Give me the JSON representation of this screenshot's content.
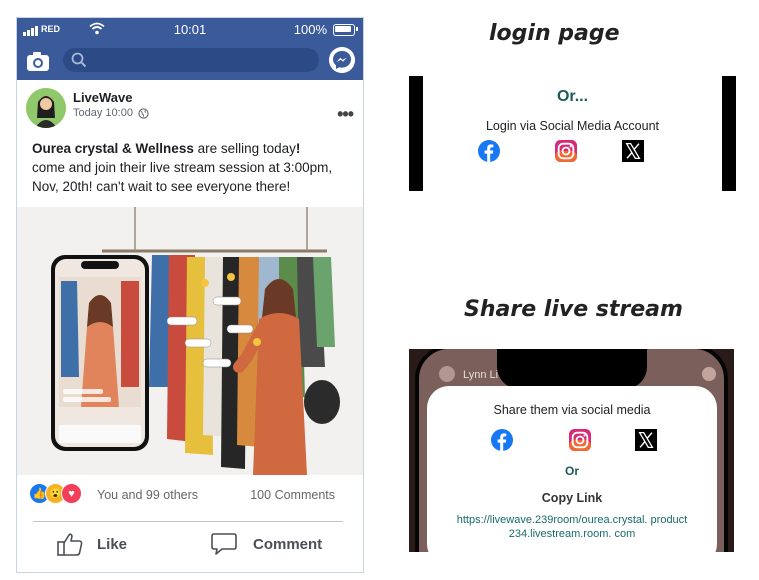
{
  "headings": {
    "login": "login page",
    "share": "Share live stream"
  },
  "status_bar": {
    "carrier": "RED",
    "time": "10:01",
    "battery": "100%"
  },
  "search": {
    "placeholder": ""
  },
  "post": {
    "author": "LiveWave",
    "time": "Today 10:00",
    "text_bold": "Ourea crystal & Wellness",
    "text_1": " are selling today",
    "text_excl": "!",
    "text_2": "come and join their live stream session at 3:00pm, Nov, 20th! can't wait to see everyone there!",
    "reactions_text": "You and 99 others",
    "comments_count": "100 Comments",
    "like_label": "Like",
    "comment_label": "Comment"
  },
  "login_panel": {
    "or_label": "Or...",
    "label": "Login via Social Media Account",
    "icons": [
      "facebook-icon",
      "instagram-icon",
      "x-icon"
    ]
  },
  "share_panel": {
    "profile_name": "Lynn Li",
    "label": "Share them via social media",
    "or_label": "Or",
    "copy_label": "Copy Link",
    "link_line1": "https://livewave.239room/ourea.crystal. product",
    "link_line2": "234.livestream.room. com"
  },
  "colors": {
    "fb_blue": "#3b5a9a",
    "facebook": "#1877f2",
    "accent_teal": "#1c5a5a"
  }
}
